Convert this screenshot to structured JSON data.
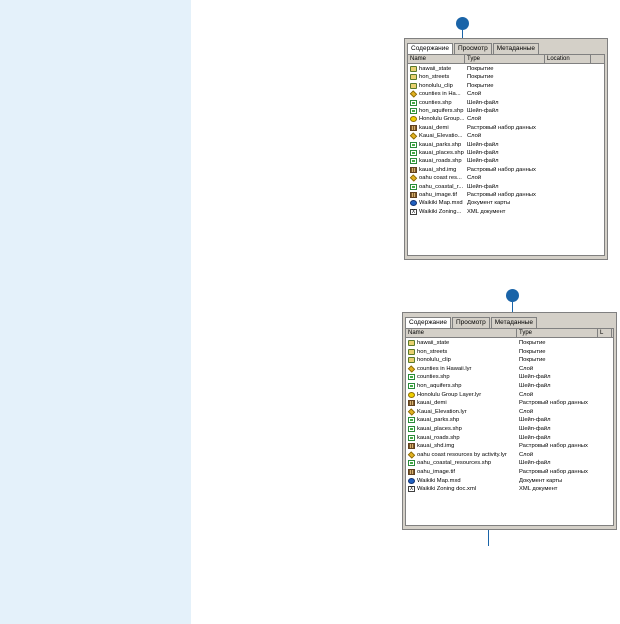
{
  "colors": {
    "sidebar": "#e4f1fa",
    "callout": "#1a64a8",
    "window": "#d4d0c8"
  },
  "window_top": {
    "tabs": [
      "Содержание",
      "Просмотр",
      "Метаданные"
    ],
    "columns": [
      "Name",
      "Type",
      "Location"
    ],
    "rows": [
      {
        "icon": "coverage-icon",
        "name": "hawaii_state",
        "type": "Покрытие"
      },
      {
        "icon": "coverage-icon",
        "name": "hon_streets",
        "type": "Покрытие"
      },
      {
        "icon": "coverage-icon",
        "name": "honolulu_clip",
        "type": "Покрытие"
      },
      {
        "icon": "layer-icon",
        "name": "counties in Ha...",
        "type": "Слой"
      },
      {
        "icon": "shapefile-icon",
        "name": "counties.shp",
        "type": "Шейп-файл"
      },
      {
        "icon": "shapefile-icon",
        "name": "hon_aquifers.shp",
        "type": "Шейп-файл"
      },
      {
        "icon": "group-layer-icon",
        "name": "Honolulu Group...",
        "type": "Слой"
      },
      {
        "icon": "raster-icon",
        "name": "kauai_demi",
        "type": "Растровый набор данных"
      },
      {
        "icon": "layer-icon",
        "name": "Kauai_Elevatio...",
        "type": "Слой"
      },
      {
        "icon": "shapefile-icon",
        "name": "kauai_parks.shp",
        "type": "Шейп-файл"
      },
      {
        "icon": "shapefile-icon",
        "name": "kauai_places.shp",
        "type": "Шейп-файл"
      },
      {
        "icon": "shapefile-icon",
        "name": "kauai_roads.shp",
        "type": "Шейп-файл"
      },
      {
        "icon": "raster-icon",
        "name": "kauai_shd.img",
        "type": "Растровый набор данных"
      },
      {
        "icon": "layer-icon",
        "name": "oahu coast res...",
        "type": "Слой"
      },
      {
        "icon": "shapefile-icon",
        "name": "oahu_coastal_r...",
        "type": "Шейп-файл"
      },
      {
        "icon": "raster-icon",
        "name": "oahu_image.tif",
        "type": "Растровый набор данных"
      },
      {
        "icon": "map-document-icon",
        "name": "Waikiki Map.mxd",
        "type": "Документ карты"
      },
      {
        "icon": "xml-document-icon",
        "name": "Waikiki Zoning...",
        "type": "XML документ"
      }
    ]
  },
  "window_bottom": {
    "tabs": [
      "Содержание",
      "Просмотр",
      "Метаданные"
    ],
    "columns": [
      "Name",
      "Type",
      "L"
    ],
    "rows": [
      {
        "icon": "coverage-icon",
        "name": "hawaii_state",
        "type": "Покрытие"
      },
      {
        "icon": "coverage-icon",
        "name": "hon_streets",
        "type": "Покрытие"
      },
      {
        "icon": "coverage-icon",
        "name": "honolulu_clip",
        "type": "Покрытие"
      },
      {
        "icon": "layer-icon",
        "name": "counties in Hawaii.lyr",
        "type": "Слой"
      },
      {
        "icon": "shapefile-icon",
        "name": "counties.shp",
        "type": "Шейп-файл"
      },
      {
        "icon": "shapefile-icon",
        "name": "hon_aquifers.shp",
        "type": "Шейп-файл"
      },
      {
        "icon": "group-layer-icon",
        "name": "Honolulu Group Layer.lyr",
        "type": "Слой"
      },
      {
        "icon": "raster-icon",
        "name": "kauai_demi",
        "type": "Растровый набор данных"
      },
      {
        "icon": "layer-icon",
        "name": "Kauai_Elevation.lyr",
        "type": "Слой"
      },
      {
        "icon": "shapefile-icon",
        "name": "kauai_parks.shp",
        "type": "Шейп-файл"
      },
      {
        "icon": "shapefile-icon",
        "name": "kauai_places.shp",
        "type": "Шейп-файл"
      },
      {
        "icon": "shapefile-icon",
        "name": "kauai_roads.shp",
        "type": "Шейп-файл"
      },
      {
        "icon": "raster-icon",
        "name": "kauai_shd.img",
        "type": "Растровый набор данных"
      },
      {
        "icon": "layer-icon",
        "name": "oahu coast resources by activity.lyr",
        "type": "Слой"
      },
      {
        "icon": "shapefile-icon",
        "name": "oahu_coastal_resources.shp",
        "type": "Шейп-файл"
      },
      {
        "icon": "raster-icon",
        "name": "oahu_image.tif",
        "type": "Растровый набор данных"
      },
      {
        "icon": "map-document-icon",
        "name": "Waikiki Map.mxd",
        "type": "Документ карты"
      },
      {
        "icon": "xml-document-icon",
        "name": "Waikiki Zoning doc.xml",
        "type": "XML документ"
      }
    ]
  }
}
